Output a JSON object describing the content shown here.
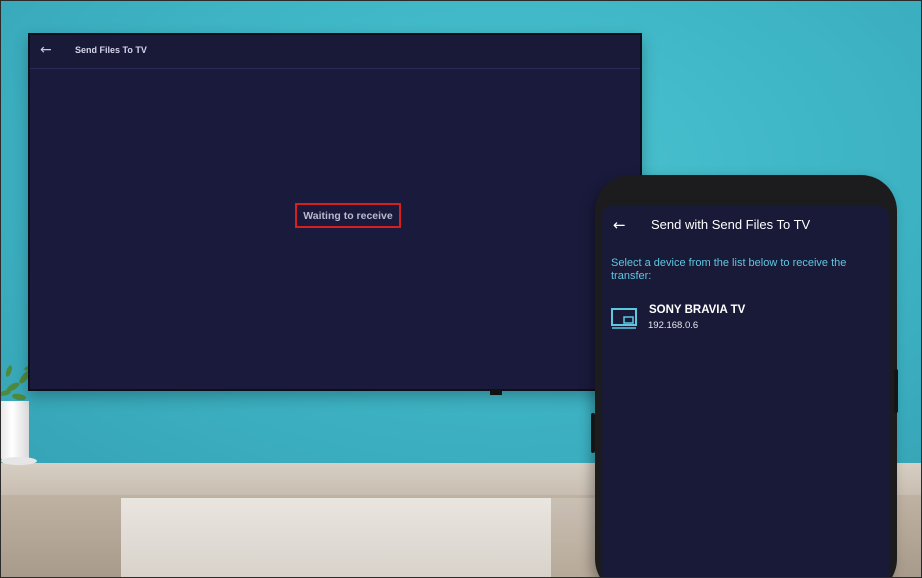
{
  "tv": {
    "app_title": "Send Files To TV",
    "status_text": "Waiting to receive",
    "back_icon": "arrow-left-icon"
  },
  "phone": {
    "screen_title": "Send with Send Files To TV",
    "back_icon": "arrow-left-icon",
    "instruction": "Select a device from the list below to receive the transfer:",
    "devices": [
      {
        "name": "SONY BRAVIA TV",
        "ip": "192.168.0.6",
        "icon": "tv-device-icon"
      }
    ]
  },
  "colors": {
    "app_background": "#1a1a3d",
    "highlight_border": "#d81e1e",
    "instruction_text": "#5fc7e0",
    "wall": "#3fb6c6"
  }
}
